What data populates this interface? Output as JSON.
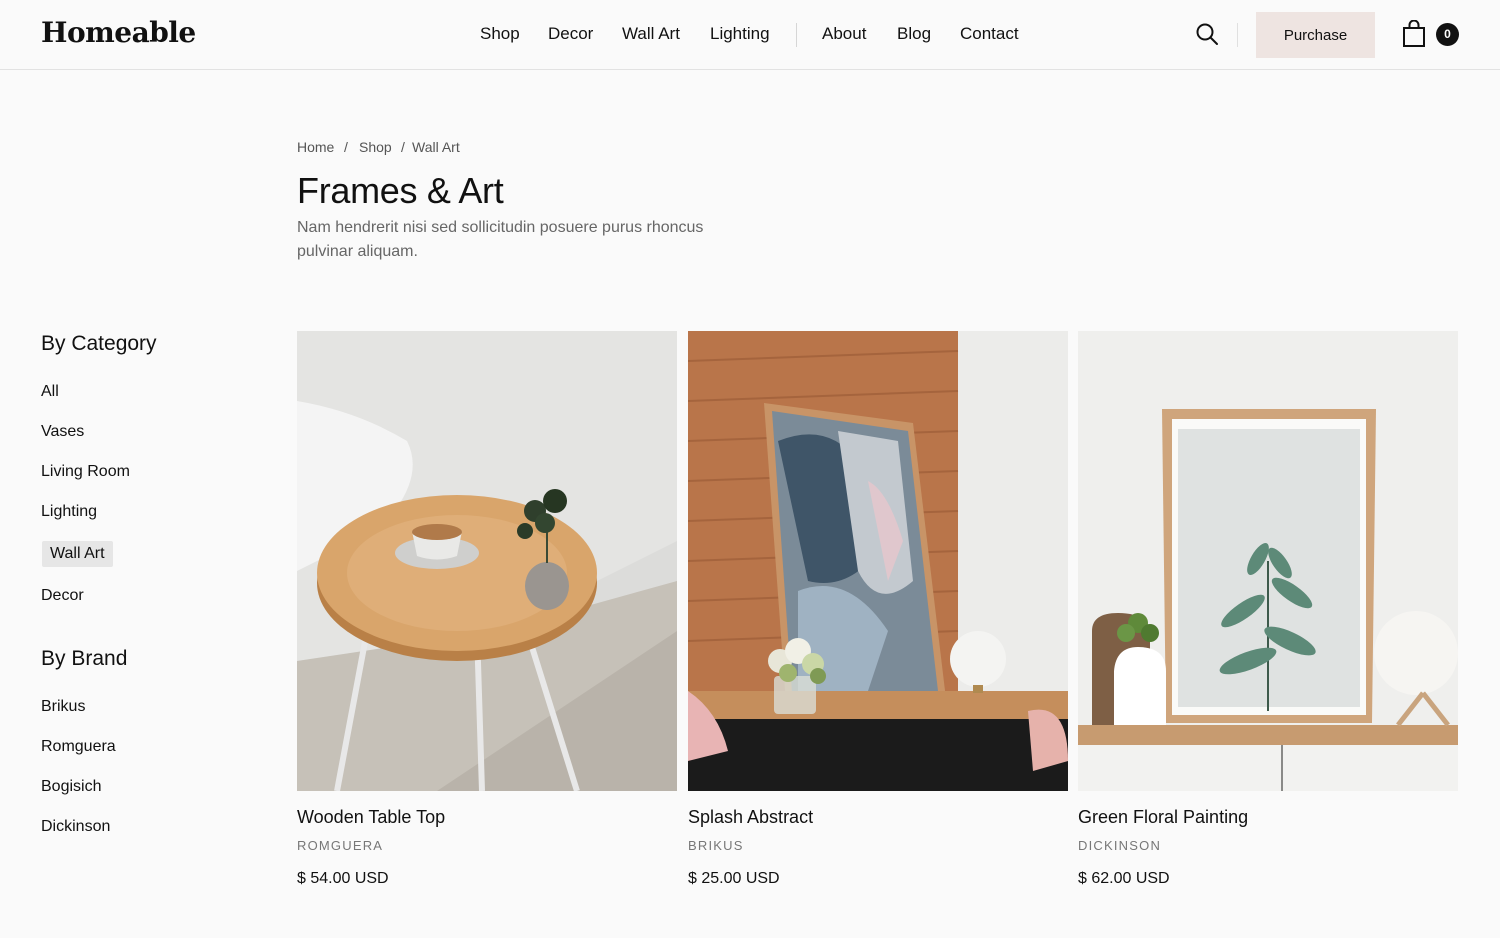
{
  "header": {
    "logo": "Homeable",
    "nav": [
      "Shop",
      "Decor",
      "Wall Art",
      "Lighting",
      "About",
      "Blog",
      "Contact"
    ],
    "purchase_label": "Purchase",
    "cart_count": "0"
  },
  "breadcrumb": {
    "home": "Home",
    "shop": "Shop",
    "current": "Wall Art",
    "separator": "/"
  },
  "page": {
    "title": "Frames & Art",
    "description": "Nam hendrerit nisi sed sollicitudin posuere purus rhoncus pulvinar aliquam."
  },
  "sidebar": {
    "category_heading": "By Category",
    "categories": [
      "All",
      "Vases",
      "Living Room",
      "Lighting",
      "Wall Art",
      "Decor"
    ],
    "active_category": "Wall Art",
    "brand_heading": "By Brand",
    "brands": [
      "Brikus",
      "Romguera",
      "Bogisich",
      "Dickinson"
    ]
  },
  "products": [
    {
      "name": "Wooden Table Top",
      "brand": "ROMGUERA",
      "price": "$ 54.00 USD"
    },
    {
      "name": "Splash Abstract",
      "brand": "BRIKUS",
      "price": "$ 25.00 USD"
    },
    {
      "name": "Green Floral Painting",
      "brand": "DICKINSON",
      "price": "$ 62.00 USD"
    }
  ],
  "icons": {
    "search": "search-icon",
    "cart": "shopping-bag-icon"
  },
  "colors": {
    "purchase_bg": "#eee4e1",
    "badge_bg": "#111111",
    "active_bg": "#e6e6e6"
  }
}
